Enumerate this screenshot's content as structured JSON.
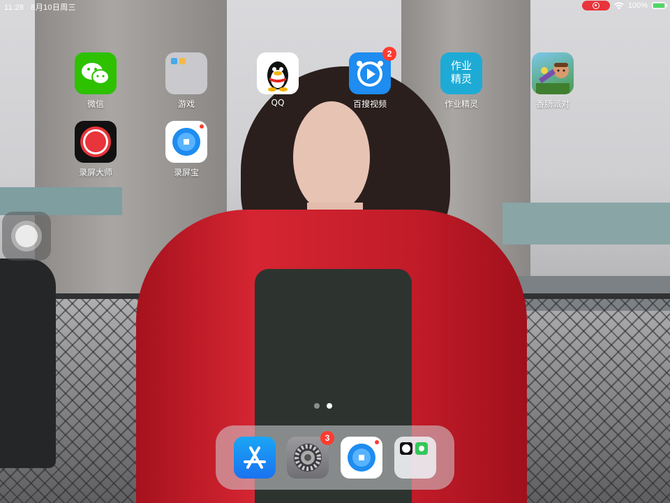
{
  "status_bar": {
    "time": "11:28",
    "date": "8月10日周三",
    "battery": "100%"
  },
  "colors": {
    "wechat": "#2dc100",
    "qq_bg": "#ffffff",
    "baidu_video": "#1e8cf0",
    "zuoye": "#1dabd6",
    "badge": "#ff3b30",
    "recording": "#e8343a"
  },
  "apps": [
    {
      "label": "微信",
      "icon": "wechat-icon"
    },
    {
      "label": "游戏",
      "icon": "games-folder-icon"
    },
    {
      "label": "QQ",
      "icon": "qq-penguin-icon"
    },
    {
      "label": "百搜视频",
      "icon": "baidu-video-icon",
      "badge": "2"
    },
    {
      "label": "作业精灵",
      "icon": "zuoye-jingling-icon",
      "icon_text_1": "作业",
      "icon_text_2": "精灵"
    },
    {
      "label": "香肠派对",
      "icon": "sausage-party-icon"
    },
    {
      "label": "录屏大师",
      "icon": "record-master-icon"
    },
    {
      "label": "录屏宝",
      "icon": "record-bao-icon"
    }
  ],
  "dock": [
    {
      "name": "App Store",
      "icon": "app-store-icon"
    },
    {
      "name": "Settings",
      "icon": "settings-gear-icon",
      "badge": "3"
    },
    {
      "name": "录屏宝",
      "icon": "record-bao-icon"
    },
    {
      "name": "folder",
      "icon": "utilities-folder-icon"
    }
  ],
  "page_indicator": {
    "pages": 2,
    "current": 2
  }
}
